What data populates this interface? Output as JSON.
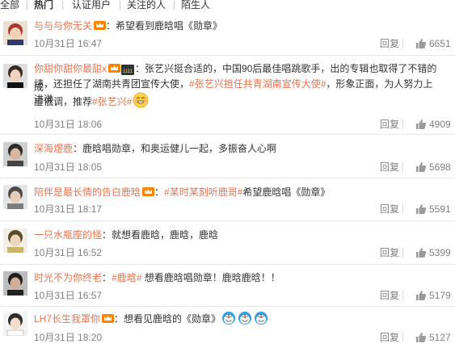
{
  "tabs": [
    "全部",
    "热门",
    "认证用户",
    "关注的人",
    "陌生人"
  ],
  "comments": [
    {
      "user": "与与与你无关",
      "sep": "：",
      "text": "希望看到鹿晗唱《勋章》",
      "time": "10月31日 16:47",
      "reply": "回复",
      "likes": "6651"
    },
    {
      "user": "你甜你甜你最甜x",
      "sep": "：",
      "line1": "张艺兴挺合适的，中国90后最佳唱跳歌手，出的专辑也取得了不错的成",
      "line2a": "绩，还担任了湖南共青团宣传大使，",
      "tag": "#张艺兴担任共青湖南宣传大使#",
      "line2b": "，形象正面，为人努力上进谦",
      "line3a": "虚低调，推荐",
      "tag2": "#张艺兴#",
      "time": "10月31日 18:06",
      "reply": "回复",
      "likes": "4909"
    },
    {
      "user": "深海煜鹿",
      "sep": "：",
      "text": "鹿晗唱勋章，和奥运健儿一起，多振奋人心啊",
      "time": "10月31日 18:05",
      "reply": "回复",
      "likes": "5698"
    },
    {
      "user": "陪伴是最长情的告白鹿晗",
      "sep": "：",
      "tag": "#某时某刻听鹿哥#",
      "text": "希望鹿晗唱《勋章》",
      "time": "10月31日 18:17",
      "reply": "回复",
      "likes": "5591"
    },
    {
      "user": "一只水瓶座的怪",
      "sep": "：",
      "text": "就想看鹿晗，鹿晗，鹿晗",
      "time": "10月31日 16:52",
      "reply": "回复",
      "likes": "5399"
    },
    {
      "user": "时光不为你终老",
      "sep": "：",
      "tag": "#鹿晗#",
      "text": "  想看鹿晗唱勋章！鹿晗鹿晗！！",
      "time": "10月31日 16:57",
      "reply": "回复",
      "likes": "5179"
    },
    {
      "user": "LH7长生我罩你",
      "sep": "：",
      "text": "想看见鹿晗的《勋章》",
      "time": "10月31日 18:20",
      "reply": "回复",
      "likes": "5127"
    }
  ],
  "colors": {
    "link": "#eb7350",
    "meta": "#808080",
    "text": "#333333",
    "divider": "#e6e6e6"
  },
  "icons": [
    "vip-crown-icon",
    "thumb-up-icon",
    "doraemon-emoji-icon",
    "grin-emoji-icon",
    "cat-emoji-icon"
  ]
}
